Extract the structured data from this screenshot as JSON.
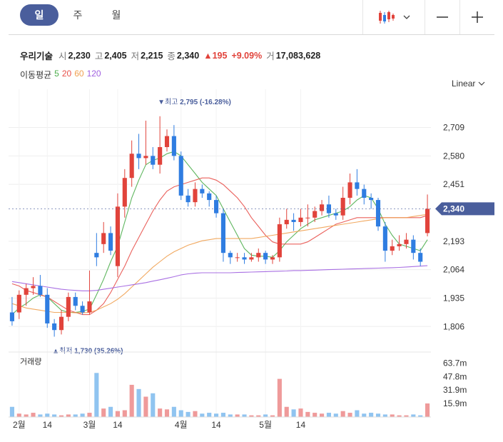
{
  "toolbar": {
    "periods": [
      "일",
      "주",
      "월"
    ],
    "active_period": "일",
    "chart_type_icon": "candlestick-icon",
    "dropdown_icon": "chevron-down-icon",
    "zoom_out_icon": "minus-icon",
    "zoom_in_icon": "plus-icon"
  },
  "quote": {
    "name": "우리기술",
    "open_label": "시",
    "open": "2,230",
    "high_label": "고",
    "high": "2,405",
    "low_label": "저",
    "low": "2,215",
    "close_label": "종",
    "close": "2,340",
    "change": "▲195",
    "change_pct": "+9.09%",
    "volume_label": "거",
    "volume": "17,083,628"
  },
  "ma_legend": {
    "title": "이동평균",
    "periods": [
      "5",
      "20",
      "60",
      "120"
    ],
    "colors": [
      "#4cae4c",
      "#e8504a",
      "#f0a050",
      "#a060e0"
    ]
  },
  "scale": {
    "label": "Linear"
  },
  "colors": {
    "up": "#e1433b",
    "down": "#2f7de1",
    "accent": "#4a5e9c",
    "vol_up": "#ef9a9a",
    "vol_down": "#90c4f0"
  },
  "chart_data": {
    "type": "candlestick",
    "ylim": [
      1700,
      2850
    ],
    "price_ticks": [
      "2,709",
      "2,580",
      "2,451",
      "2,193",
      "2,064",
      "1,935",
      "1,806"
    ],
    "price_tick_values": [
      2709,
      2580,
      2451,
      2193,
      2064,
      1935,
      1806
    ],
    "current_price_label": "2,340",
    "current_price": 2340,
    "high_marker": {
      "label": "▼최고",
      "value": "2,795 (-16.28%)",
      "price": 2795,
      "bar": 21
    },
    "low_marker": {
      "label": "▲최저",
      "value": "1,730 (35.26%)",
      "price": 1730,
      "bar": 6
    },
    "x_ticks": [
      {
        "label": "2월",
        "bar": 1
      },
      {
        "label": "14",
        "bar": 5
      },
      {
        "label": "3월",
        "bar": 11
      },
      {
        "label": "14",
        "bar": 15
      },
      {
        "label": "4월",
        "bar": 24
      },
      {
        "label": "14",
        "bar": 29
      },
      {
        "label": "5월",
        "bar": 36
      },
      {
        "label": "14",
        "bar": 41
      }
    ],
    "candles": [
      [
        1870,
        1830,
        1940,
        1810
      ],
      [
        1870,
        1950,
        1970,
        1840
      ],
      [
        1950,
        1980,
        2000,
        1900
      ],
      [
        1980,
        1990,
        2030,
        1950
      ],
      [
        1990,
        1950,
        2040,
        1940
      ],
      [
        1950,
        1820,
        1980,
        1800
      ],
      [
        1820,
        1790,
        1840,
        1760
      ],
      [
        1790,
        1850,
        1880,
        1770
      ],
      [
        1850,
        1940,
        1960,
        1830
      ],
      [
        1940,
        1900,
        1960,
        1880
      ],
      [
        1900,
        1870,
        1920,
        1860
      ],
      [
        1870,
        1920,
        2060,
        1860
      ],
      [
        2140,
        2120,
        2230,
        2080
      ],
      [
        2180,
        2230,
        2280,
        2140
      ],
      [
        2230,
        2150,
        2260,
        2130
      ],
      [
        2080,
        2350,
        2410,
        2030
      ],
      [
        2350,
        2480,
        2520,
        2300
      ],
      [
        2480,
        2590,
        2650,
        2440
      ],
      [
        2590,
        2570,
        2680,
        2520
      ],
      [
        2570,
        2580,
        2740,
        2540
      ],
      [
        2580,
        2540,
        2620,
        2520
      ],
      [
        2540,
        2620,
        2760,
        2500
      ],
      [
        2620,
        2670,
        2700,
        2600
      ],
      [
        2670,
        2580,
        2720,
        2560
      ],
      [
        2580,
        2400,
        2600,
        2380
      ],
      [
        2400,
        2370,
        2430,
        2350
      ],
      [
        2370,
        2430,
        2460,
        2350
      ],
      [
        2430,
        2410,
        2450,
        2390
      ],
      [
        2410,
        2380,
        2420,
        2350
      ],
      [
        2380,
        2320,
        2400,
        2300
      ],
      [
        2320,
        2140,
        2340,
        2100
      ],
      [
        2140,
        2120,
        2150,
        2090
      ],
      [
        2120,
        2120,
        2140,
        2100
      ],
      [
        2120,
        2110,
        2140,
        2090
      ],
      [
        2110,
        2120,
        2140,
        2100
      ],
      [
        2120,
        2140,
        2160,
        2100
      ],
      [
        2140,
        2110,
        2150,
        2090
      ],
      [
        2110,
        2120,
        2130,
        2090
      ],
      [
        2120,
        2270,
        2300,
        2100
      ],
      [
        2270,
        2290,
        2340,
        2250
      ],
      [
        2290,
        2280,
        2320,
        2240
      ],
      [
        2280,
        2300,
        2340,
        2260
      ],
      [
        2300,
        2300,
        2360,
        2260
      ],
      [
        2300,
        2330,
        2350,
        2280
      ],
      [
        2330,
        2360,
        2380,
        2310
      ],
      [
        2360,
        2320,
        2400,
        2300
      ],
      [
        2320,
        2310,
        2340,
        2290
      ],
      [
        2310,
        2390,
        2440,
        2290
      ],
      [
        2390,
        2460,
        2500,
        2360
      ],
      [
        2460,
        2430,
        2520,
        2400
      ],
      [
        2430,
        2390,
        2450,
        2360
      ],
      [
        2390,
        2380,
        2410,
        2340
      ],
      [
        2380,
        2260,
        2390,
        2240
      ],
      [
        2260,
        2150,
        2280,
        2100
      ],
      [
        2150,
        2170,
        2200,
        2130
      ],
      [
        2170,
        2180,
        2220,
        2150
      ],
      [
        2180,
        2200,
        2230,
        2160
      ],
      [
        2200,
        2140,
        2220,
        2110
      ],
      [
        2140,
        2100,
        2160,
        2080
      ],
      [
        2230,
        2340,
        2405,
        2215
      ]
    ],
    "volume_ticks": [
      "63.7m",
      "47.8m",
      "31.9m",
      "15.9m"
    ],
    "volume_tick_values": [
      63.7,
      47.8,
      31.9,
      15.9
    ],
    "volume_max": 75,
    "volume_title": "거래량",
    "volumes": [
      12,
      4,
      3,
      5,
      3,
      4,
      3,
      2,
      3,
      3,
      4,
      5,
      52,
      10,
      12,
      7,
      8,
      38,
      33,
      24,
      28,
      10,
      9,
      12,
      8,
      6,
      7,
      4,
      5,
      4,
      5,
      3,
      3,
      3,
      2,
      2,
      3,
      2,
      45,
      12,
      9,
      10,
      6,
      5,
      4,
      5,
      4,
      7,
      5,
      8,
      4,
      5,
      4,
      3,
      3,
      2,
      2,
      3,
      2,
      16
    ],
    "ma_series": {
      "5": [
        1860,
        1890,
        1910,
        1935,
        1950,
        1940,
        1910,
        1880,
        1870,
        1870,
        1875,
        1885,
        1950,
        2020,
        2100,
        2170,
        2280,
        2390,
        2470,
        2540,
        2560,
        2570,
        2590,
        2600,
        2580,
        2540,
        2500,
        2460,
        2430,
        2400,
        2340,
        2280,
        2220,
        2160,
        2130,
        2125,
        2125,
        2120,
        2150,
        2190,
        2220,
        2250,
        2270,
        2290,
        2300,
        2310,
        2320,
        2330,
        2350,
        2380,
        2400,
        2390,
        2340,
        2270,
        2220,
        2180,
        2170,
        2160,
        2150,
        2200
      ],
      "20": [
        2000,
        1990,
        1970,
        1960,
        1950,
        1940,
        1920,
        1900,
        1880,
        1870,
        1860,
        1860,
        1880,
        1910,
        1960,
        2020,
        2080,
        2150,
        2210,
        2270,
        2330,
        2380,
        2420,
        2440,
        2450,
        2460,
        2470,
        2480,
        2480,
        2470,
        2450,
        2420,
        2390,
        2350,
        2300,
        2260,
        2220,
        2190,
        2180,
        2180,
        2180,
        2180,
        2190,
        2210,
        2230,
        2250,
        2270,
        2280,
        2290,
        2300,
        2300,
        2300,
        2300,
        2300,
        2300,
        2300,
        2300,
        2300,
        2300,
        2310
      ],
      "60": [
        1910,
        1900,
        1890,
        1885,
        1880,
        1875,
        1870,
        1870,
        1870,
        1868,
        1868,
        1870,
        1880,
        1895,
        1910,
        1930,
        1955,
        1985,
        2015,
        2045,
        2075,
        2100,
        2125,
        2145,
        2160,
        2175,
        2185,
        2195,
        2200,
        2205,
        2205,
        2205,
        2205,
        2205,
        2205,
        2210,
        2215,
        2220,
        2225,
        2230,
        2235,
        2240,
        2245,
        2250,
        2255,
        2260,
        2265,
        2270,
        2275,
        2280,
        2285,
        2290,
        2295,
        2300,
        2300,
        2300,
        2300,
        2305,
        2310,
        2315
      ],
      "120": [
        2010,
        2005,
        2000,
        1995,
        1990,
        1985,
        1980,
        1975,
        1972,
        1970,
        1968,
        1968,
        1970,
        1975,
        1980,
        1985,
        1990,
        1995,
        2000,
        2005,
        2012,
        2018,
        2025,
        2032,
        2040,
        2045,
        2048,
        2050,
        2050,
        2050,
        2050,
        2050,
        2051,
        2052,
        2053,
        2054,
        2055,
        2056,
        2057,
        2058,
        2060,
        2060,
        2061,
        2062,
        2063,
        2064,
        2065,
        2066,
        2067,
        2068,
        2069,
        2070,
        2071,
        2072,
        2073,
        2074,
        2076,
        2078,
        2080,
        2082
      ]
    }
  }
}
